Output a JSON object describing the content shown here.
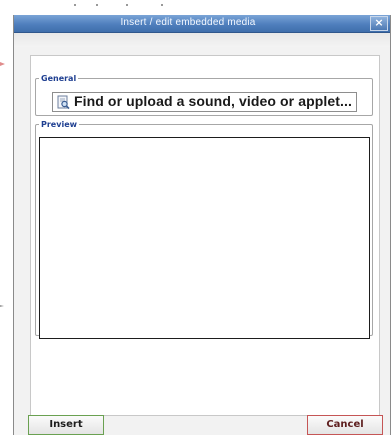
{
  "dialog": {
    "title": "Insert / edit embedded media",
    "close_glyph": "×"
  },
  "general": {
    "legend": "General",
    "find_label": "Find or upload a sound, video or applet...",
    "find_icon": "magnifier-document-icon"
  },
  "preview": {
    "legend": "Preview"
  },
  "buttons": {
    "insert_label": "Insert",
    "cancel_label": "Cancel"
  },
  "colors": {
    "titlebar": "#4f7fbd",
    "legend": "#1f3f91",
    "insert_border": "#6aa151",
    "cancel_border": "#c55555"
  }
}
